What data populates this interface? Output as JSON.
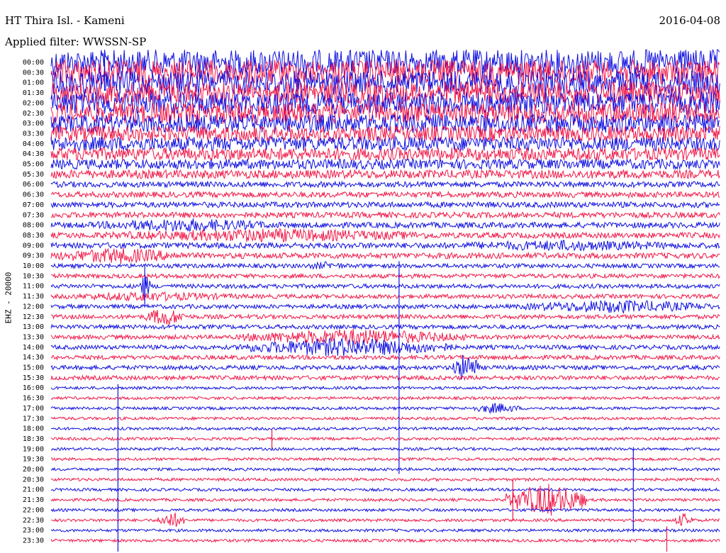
{
  "header": {
    "title": "HT Thira Isl. - Kameni",
    "date": "2016-04-08",
    "filter": "Applied filter: WWSSN-SP"
  },
  "chart_data": {
    "type": "line",
    "title": "HT Thira Isl. - Kameni",
    "ylabel": "EHZ - 20000",
    "rows": [
      "00:00",
      "00:30",
      "01:00",
      "01:30",
      "02:00",
      "02:30",
      "03:00",
      "03:30",
      "04:00",
      "04:30",
      "05:00",
      "05:30",
      "06:00",
      "06:30",
      "07:00",
      "07:30",
      "08:00",
      "08:30",
      "09:00",
      "09:30",
      "10:00",
      "10:30",
      "11:00",
      "11:30",
      "12:00",
      "12:30",
      "13:00",
      "13:30",
      "14:00",
      "14:30",
      "15:00",
      "15:30",
      "16:00",
      "16:30",
      "17:00",
      "17:30",
      "18:00",
      "18:30",
      "19:00",
      "19:30",
      "20:00",
      "20:30",
      "21:00",
      "21:30",
      "22:00",
      "22:30",
      "23:00",
      "23:30"
    ],
    "row_colors": [
      "#1010e0",
      "#f01848"
    ],
    "noise_amplitude": [
      18,
      18,
      17,
      16,
      16,
      15,
      13,
      11,
      10,
      9,
      7,
      6,
      4,
      4,
      4,
      4,
      4,
      4,
      4,
      4,
      3,
      3,
      3,
      3,
      3,
      3,
      3,
      3,
      3,
      3,
      3,
      3,
      2,
      2,
      2,
      2,
      2,
      2,
      2,
      2,
      2,
      2,
      2,
      2,
      2,
      2,
      2,
      2
    ],
    "events": [
      {
        "row": "02:30",
        "x_frac": [
          0.68,
          0.72
        ],
        "amp": 12
      },
      {
        "row": "08:00",
        "x_frac": [
          0.05,
          0.35
        ],
        "amp": 10
      },
      {
        "row": "08:30",
        "x_frac": [
          0.05,
          0.6
        ],
        "amp": 10
      },
      {
        "row": "09:00",
        "x_frac": [
          0.55,
          0.99
        ],
        "amp": 8
      },
      {
        "row": "09:30",
        "x_frac": [
          0.0,
          0.2
        ],
        "amp": 12
      },
      {
        "row": "10:00",
        "x_frac": [
          0.37,
          0.45
        ],
        "amp": 6
      },
      {
        "row": "11:00",
        "x_frac": [
          0.13,
          0.15
        ],
        "amp": 18
      },
      {
        "row": "11:30",
        "x_frac": [
          0.0,
          0.3
        ],
        "amp": 7
      },
      {
        "row": "12:00",
        "x_frac": [
          0.7,
          0.99
        ],
        "amp": 10
      },
      {
        "row": "12:30",
        "x_frac": [
          0.14,
          0.2
        ],
        "amp": 14
      },
      {
        "row": "13:30",
        "x_frac": [
          0.28,
          0.62
        ],
        "amp": 12
      },
      {
        "row": "14:00",
        "x_frac": [
          0.28,
          0.6
        ],
        "amp": 14
      },
      {
        "row": "15:00",
        "x_frac": [
          0.6,
          0.64
        ],
        "amp": 22
      },
      {
        "row": "17:00",
        "x_frac": [
          0.63,
          0.7
        ],
        "amp": 8
      },
      {
        "row": "21:30",
        "x_frac": [
          0.68,
          0.8
        ],
        "amp": 24
      },
      {
        "row": "22:30",
        "x_frac": [
          0.16,
          0.2
        ],
        "amp": 12
      },
      {
        "row": "22:30",
        "x_frac": [
          0.93,
          0.96
        ],
        "amp": 10
      }
    ],
    "spikes": [
      {
        "row": "00:00",
        "x_frac": 0.08,
        "amp": 40
      },
      {
        "row": "11:00",
        "x_frac": 0.14,
        "amp": 30
      },
      {
        "row": "15:00",
        "x_frac": 0.52,
        "amp": 150
      },
      {
        "row": "18:30",
        "x_frac": 0.33,
        "amp": 14
      },
      {
        "row": "20:00",
        "x_frac": 0.1,
        "amp": 120
      },
      {
        "row": "21:00",
        "x_frac": 0.87,
        "amp": 60
      },
      {
        "row": "21:30",
        "x_frac": 0.69,
        "amp": 30
      },
      {
        "row": "23:30",
        "x_frac": 0.92,
        "amp": 20
      }
    ]
  }
}
